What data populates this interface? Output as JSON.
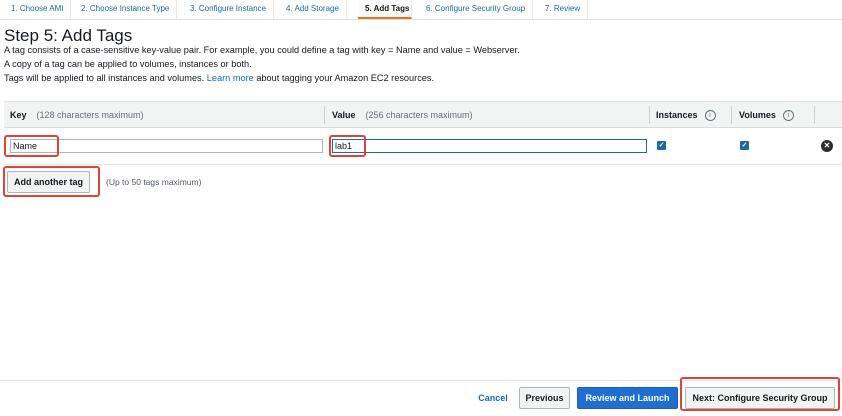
{
  "steps": [
    {
      "label": "1. Choose AMI"
    },
    {
      "label": "2. Choose Instance Type"
    },
    {
      "label": "3. Configure Instance"
    },
    {
      "label": "4. Add Storage"
    },
    {
      "label": "5. Add Tags"
    },
    {
      "label": "6. Configure Security Group"
    },
    {
      "label": "7. Review"
    }
  ],
  "page": {
    "title": "Step 5: Add Tags",
    "desc_line1": "A tag consists of a case-sensitive key-value pair. For example, you could define a tag with key = Name and value = Webserver.",
    "desc_line2": "A copy of a tag can be applied to volumes, instances or both.",
    "desc_line3_pre": "Tags will be applied to all instances and volumes.",
    "learn_more": "Learn more",
    "desc_line3_post": "about tagging your Amazon EC2 resources."
  },
  "table": {
    "key_header": "Key",
    "key_hint": "(128 characters maximum)",
    "value_header": "Value",
    "value_hint": "(256 characters maximum)",
    "instances_header": "Instances",
    "volumes_header": "Volumes",
    "info_glyph": "i",
    "rows": [
      {
        "key": "Name",
        "value": "lab1",
        "instances": true,
        "volumes": true
      }
    ],
    "check_glyph": "✓",
    "remove_glyph": "✕"
  },
  "add_tag": {
    "button": "Add another tag",
    "note": "(Up to 50 tags maximum)"
  },
  "footer": {
    "cancel": "Cancel",
    "previous": "Previous",
    "review_launch": "Review and Launch",
    "next": "Next: Configure Security Group"
  },
  "colors": {
    "accent": "#ec7211",
    "link": "#1a6aa6",
    "primary_button": "#1f6fd1",
    "highlight": "#d9473b"
  }
}
